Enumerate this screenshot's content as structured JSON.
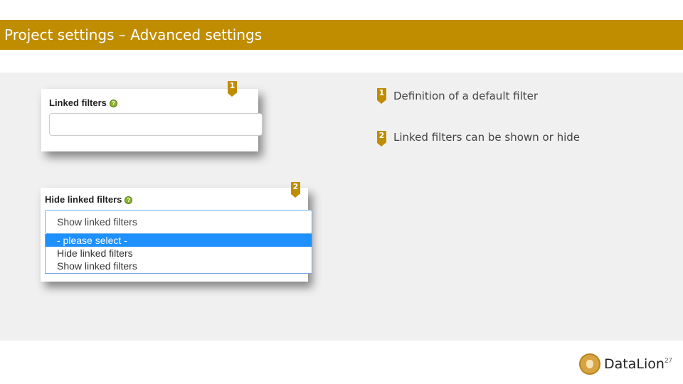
{
  "header": {
    "title": "Project settings – Advanced settings"
  },
  "card1": {
    "label": "Linked filters",
    "help": "?",
    "input_value": ""
  },
  "card2": {
    "label": "Hide linked filters",
    "help": "?",
    "selected_value": "Show linked filters",
    "options": [
      {
        "label": "- please select -",
        "highlighted": true
      },
      {
        "label": "Hide linked filters",
        "highlighted": false
      },
      {
        "label": "Show linked filters",
        "highlighted": false
      }
    ]
  },
  "markers": [
    "1",
    "2"
  ],
  "legend": [
    {
      "number": "1",
      "text": "Definition of a default filter"
    },
    {
      "number": "2",
      "text": "Linked filters can be shown or hide"
    }
  ],
  "footer": {
    "logo_text": "DataLion",
    "page_number": "27"
  },
  "colors": {
    "accent": "#c08c00",
    "content_bg": "#f0f0f0",
    "option_highlight": "#1e90ff"
  }
}
